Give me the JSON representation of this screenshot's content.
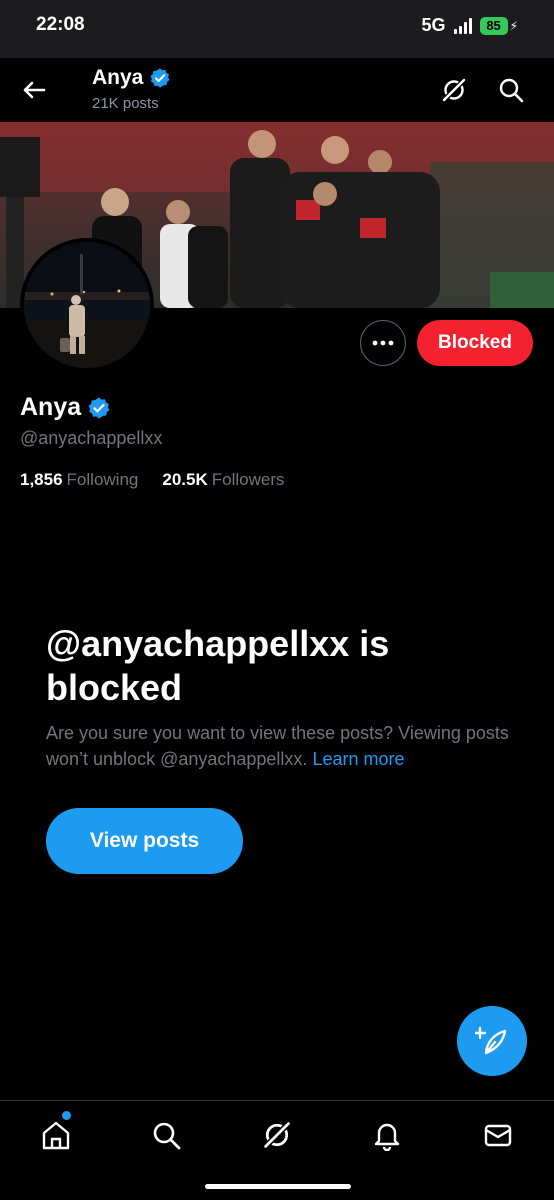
{
  "status_bar": {
    "time": "22:08",
    "network": "5G",
    "battery": "85"
  },
  "header": {
    "name": "Anya",
    "posts_count": "21K posts",
    "icons": [
      "back-arrow-icon",
      "grok-icon",
      "search-icon"
    ]
  },
  "profile": {
    "name": "Anya",
    "handle": "@anyachappellxx",
    "verified": true,
    "following_count": "1,856",
    "following_label": "Following",
    "followers_count": "20.5K",
    "followers_label": "Followers",
    "more_icon": "more-horizontal-icon",
    "blocked_label": "Blocked"
  },
  "blocked_notice": {
    "title": "@anyachappellxx is blocked",
    "description": "Are you sure you want to view these posts? Viewing posts won’t unblock @anyachappellxx.",
    "learn_more": "Learn more",
    "view_posts_label": "View posts"
  },
  "fab": {
    "icon": "compose-post-icon"
  },
  "bottom_nav": {
    "items": [
      "home-icon",
      "search-icon",
      "grok-icon",
      "notifications-icon",
      "messages-icon"
    ]
  },
  "colors": {
    "accent": "#1d9bf0",
    "blocked": "#f4212e",
    "background": "#000000",
    "battery": "#34c759"
  }
}
